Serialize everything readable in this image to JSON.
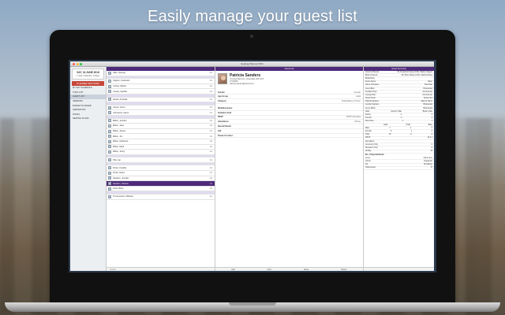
{
  "headline": "Easily manage your guest list",
  "window": {
    "title": "Seating Planner PRO"
  },
  "sidebar": {
    "date_main": "SAT, 16 JUNE 2018",
    "date_sub": "1 Year, 8 Months, 3 Days",
    "header": "PLANNER SECTIONS",
    "items": [
      {
        "label": "MY DAY SCHEDULE"
      },
      {
        "label": "TODO LIST"
      },
      {
        "label": "GUEST LIST"
      },
      {
        "label": "VENDORS"
      },
      {
        "label": "BUDGET PLANNER"
      },
      {
        "label": "INSPIRATION"
      },
      {
        "label": "NOTES"
      },
      {
        "label": "SEATING PLANS"
      }
    ]
  },
  "list": {
    "footer_search": "Search",
    "rows": [
      {
        "type": "guest",
        "name": "Allen, George",
        "count": "1/1"
      },
      {
        "type": "group"
      },
      {
        "type": "guest",
        "name": "Clayton, Frederick",
        "count": "1/1"
      },
      {
        "type": "guest",
        "name": "Conley, Marion",
        "count": "1/1"
      },
      {
        "type": "guest",
        "name": "Conley, Sparkle",
        "count": "1/1"
      },
      {
        "type": "group"
      },
      {
        "type": "guest",
        "name": "Hewitt, Amanda",
        "count": "1/1"
      },
      {
        "type": "group"
      },
      {
        "type": "guest",
        "name": "James, Kevin",
        "count": "1/1"
      },
      {
        "type": "guest",
        "name": "Johnstone, Aaron",
        "count": "1/1"
      },
      {
        "type": "group"
      },
      {
        "type": "guest",
        "name": "Milton, Jennifer",
        "count": "1/1"
      },
      {
        "type": "guest",
        "name": "Milton, Jane",
        "count": "1/1"
      },
      {
        "type": "guest",
        "name": "Milton, James",
        "count": "1/1"
      },
      {
        "type": "guest",
        "name": "Milton, Jim",
        "count": "1/1"
      },
      {
        "type": "guest",
        "name": "Milton, Katherine",
        "count": "1/1"
      },
      {
        "type": "guest",
        "name": "Milton, Mark",
        "count": "1/1"
      },
      {
        "type": "guest",
        "name": "Milton, Jenny",
        "count": "1/1"
      },
      {
        "type": "group"
      },
      {
        "type": "guest",
        "name": "Pitts, Ian",
        "count": "1/1"
      },
      {
        "type": "group"
      },
      {
        "type": "guest",
        "name": "Porter, Freddie",
        "count": "1/1"
      },
      {
        "type": "guest",
        "name": "Porter, Helen",
        "count": "1/1"
      },
      {
        "type": "guest",
        "name": "Sanders, Jennifer",
        "count": "1/1"
      },
      {
        "type": "selected",
        "name": "Sanders, Patricia",
        "count": "1/1"
      },
      {
        "type": "guest",
        "name": "Scott, Brian",
        "count": "1/1"
      },
      {
        "type": "group"
      },
      {
        "type": "guest",
        "name": "Timmermann, Michael",
        "count": "1/1"
      }
    ]
  },
  "detail": {
    "header": "Guest List",
    "name": "Patricia Sanders",
    "address_1": "10 Greenbank Ave, Greendale VAN 12-5",
    "address_2": "07726550",
    "email": "patricia.sanders@icloud.com",
    "fields": [
      {
        "label": "Gender",
        "value": "Female"
      },
      {
        "label": "Age Group",
        "value": "Adult"
      },
      {
        "label": "Category",
        "value": "Bride/Mates of Honor"
      }
    ],
    "fields2": [
      {
        "label": "Wedding Guest",
        "value": ""
      },
      {
        "label": "Invitation Sent",
        "value": ""
      },
      {
        "label": "RSVP",
        "value": "RSVP Attending"
      },
      {
        "label": "Attendance",
        "value": "All Day"
      },
      {
        "label": "Special Needs",
        "value": ""
      },
      {
        "label": "Gift",
        "value": ""
      },
      {
        "label": "Thank You Sent",
        "value": ""
      }
    ],
    "footer": [
      "Edit",
      "Files",
      "Notes",
      "Delete"
    ]
  },
  "summary": {
    "header": "Guest Summary",
    "rows": [
      {
        "label": "Groom's Parents",
        "value": "Mr. Frederick Conley & Mrs. Marion Clayton"
      },
      {
        "label": "Bride's Parents",
        "value": "Mr. Hilton Harley & Mrs. Martha Harley"
      },
      {
        "label": "Bridal Party",
        "value": ""
      },
      {
        "label": "Kevin James",
        "value": "Usher"
      },
      {
        "label": "Aaron Johnstone",
        "value": "Best Man"
      },
      {
        "label": "Jane Milton",
        "value": "Bridesmaid"
      },
      {
        "label": "Freddie Porter",
        "value": "Groomsman"
      },
      {
        "label": "George Allen",
        "value": "Groomsman"
      },
      {
        "label": "Helen Porter",
        "value": "Flower Girl"
      },
      {
        "label": "Patricia Sanders",
        "value": "Maid of Honor"
      },
      {
        "label": "Jennifer Sanders",
        "value": "Bridesmaid"
      },
      {
        "label": "Jenny Milton",
        "value": "Bridesmaid"
      }
    ],
    "stats_header": [
      "Stats",
      "Groom's Side",
      "Bride's Side"
    ],
    "stats": [
      {
        "label": "Family",
        "a": "4",
        "b": "5"
      },
      {
        "label": "Friends",
        "a": "3",
        "b": "4"
      },
      {
        "label": "Plus Ones",
        "a": "1",
        "b": "1"
      }
    ],
    "age_header": [
      "",
      "Adult",
      "Child",
      "Baby"
    ],
    "age": [
      {
        "label": "Male",
        "a": "7",
        "b": "1",
        "c": "0"
      },
      {
        "label": "Female",
        "a": "8",
        "b": "1",
        "c": "0"
      },
      {
        "label": "Total",
        "a": "15",
        "b": "2",
        "c": "0"
      }
    ],
    "rsvp_label": "RSVP",
    "rsvp_values": "12  2  1",
    "attendance": [
      {
        "label": "Attendance",
        "value": ""
      },
      {
        "label": "Ceremony Only",
        "value": "0"
      },
      {
        "label": "Reception Only",
        "value": "0"
      },
      {
        "label": "All Day",
        "value": "12"
      }
    ],
    "needs_header": "No. of Special Needs",
    "needs": [
      {
        "label": "Jenny",
        "value": "Gluten free"
      },
      {
        "label": "James",
        "value": "Vegetarian"
      },
      {
        "label": "Ian",
        "value": "Nut allergy"
      }
    ],
    "total": {
      "label": "Total Guests",
      "value": "17"
    }
  }
}
